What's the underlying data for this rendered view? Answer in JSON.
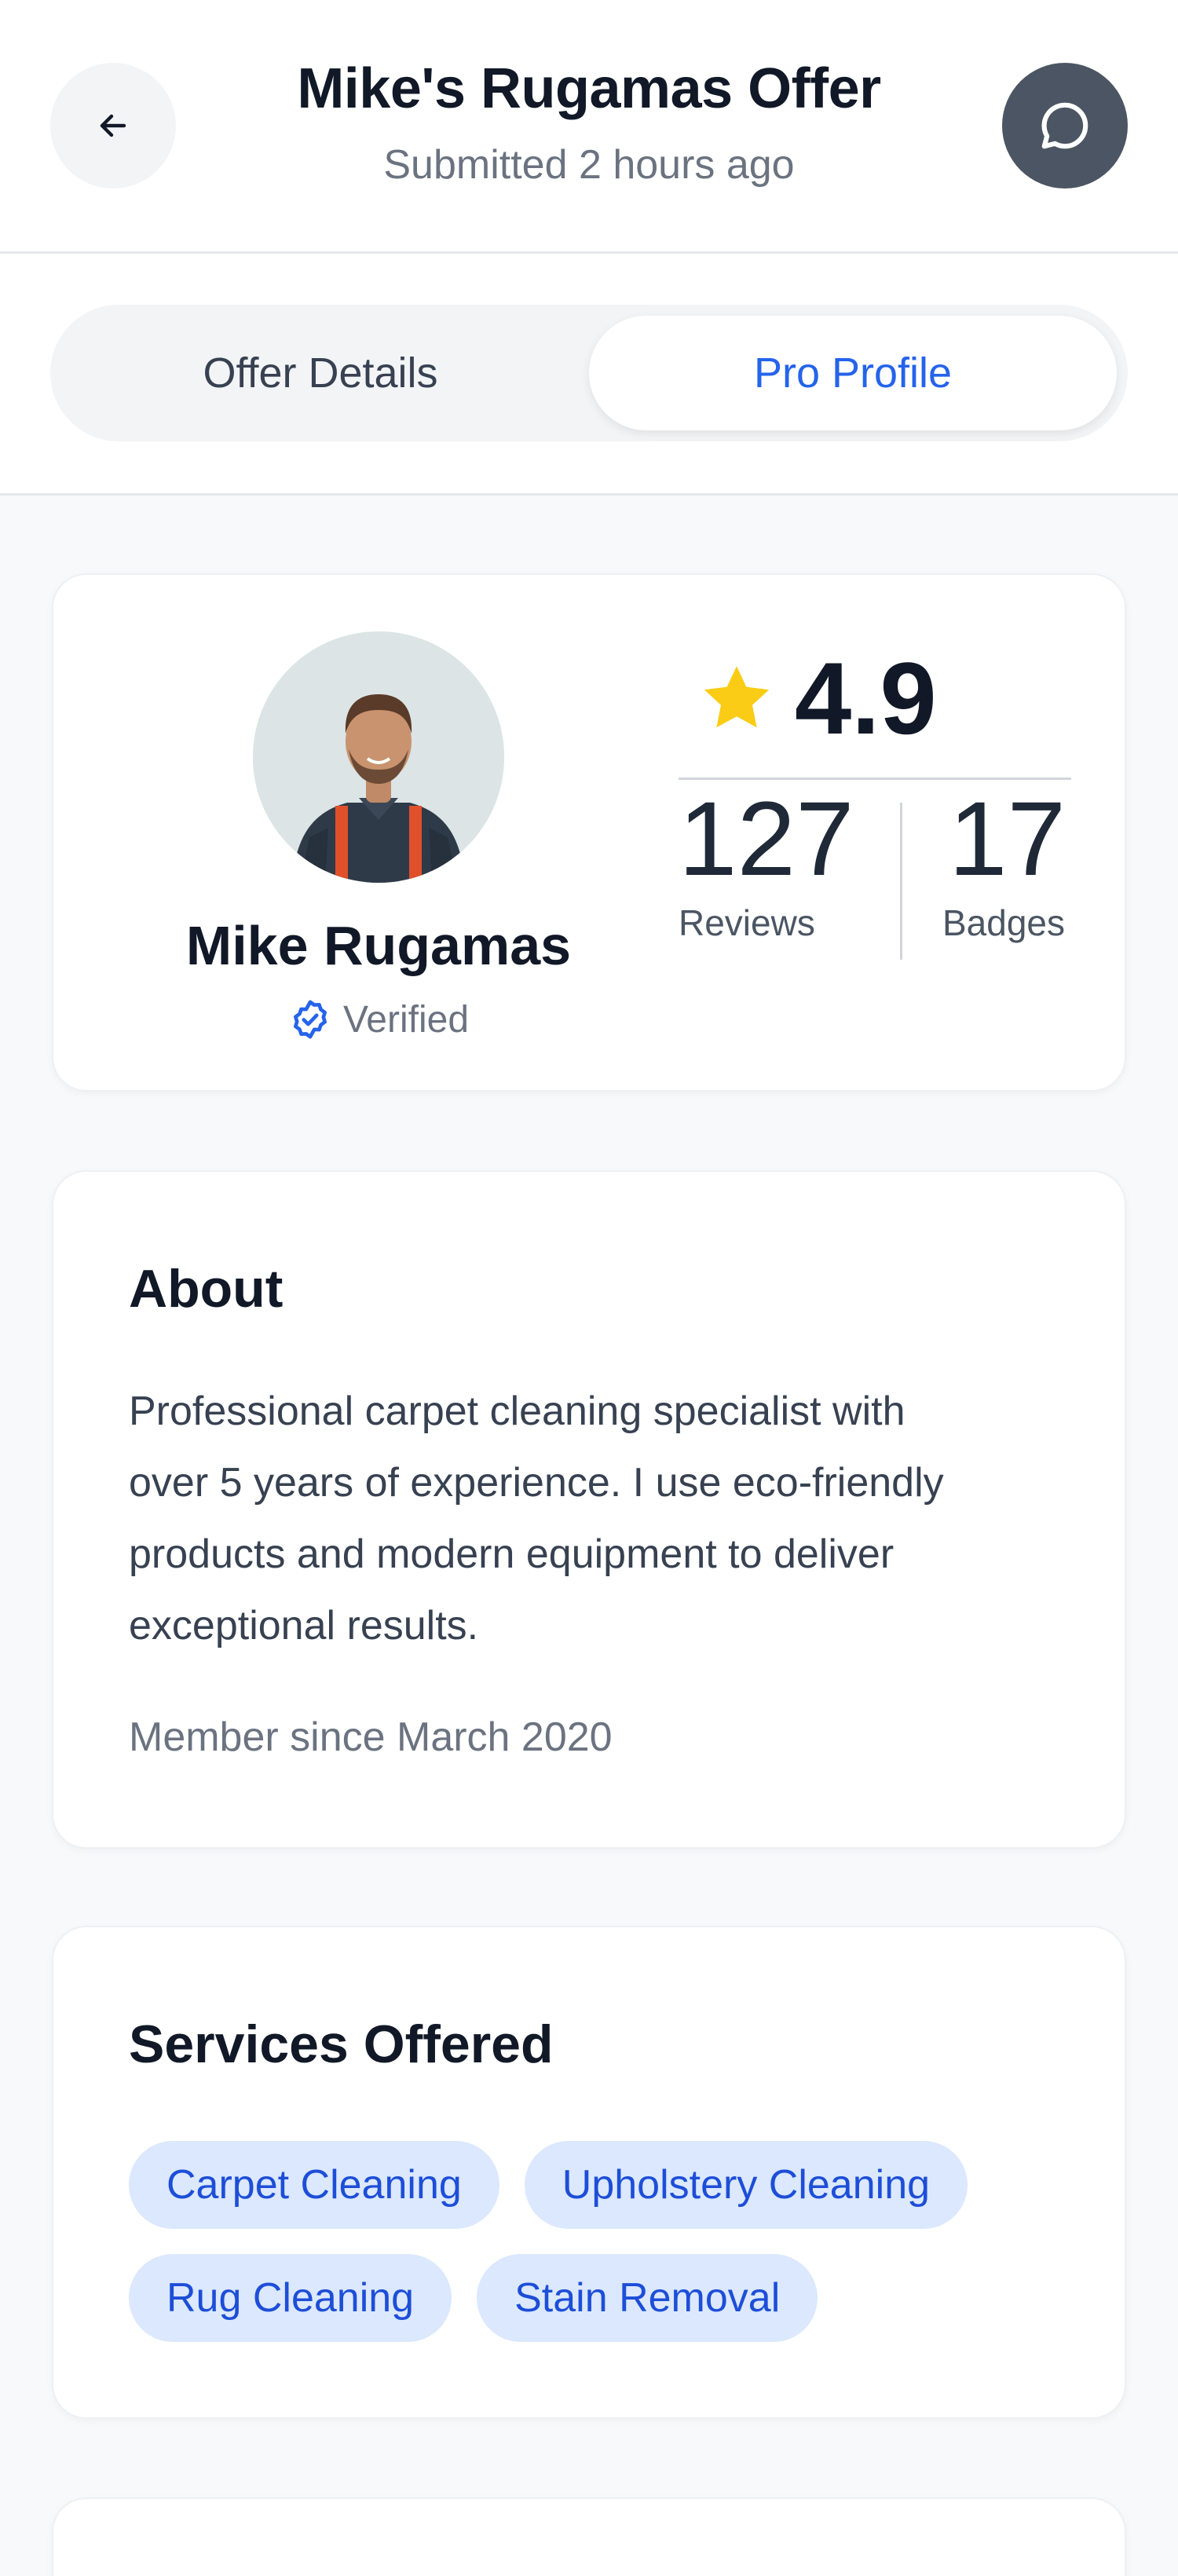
{
  "header": {
    "title": "Mike's Rugamas Offer",
    "subtitle": "Submitted 2 hours ago",
    "back_icon": "arrow-left-icon",
    "chat_icon": "chat-bubble-icon"
  },
  "tabs": [
    {
      "label": "Offer Details",
      "active": false
    },
    {
      "label": "Pro Profile",
      "active": true
    }
  ],
  "profile": {
    "name": "Mike Rugamas",
    "verified_label": "Verified",
    "rating": "4.9",
    "reviews_count": "127",
    "reviews_label": "Reviews",
    "badges_count": "17",
    "badges_label": "Badges"
  },
  "about": {
    "heading": "About",
    "lines": [
      "Professional carpet cleaning specialist with",
      "over 5 years of experience. I use eco-friendly",
      "products and modern equipment to deliver",
      "exceptional results."
    ],
    "member_since": "Member since March 2020"
  },
  "services": {
    "heading": "Services Offered",
    "items": [
      "Carpet Cleaning",
      "Upholstery Cleaning",
      "Rug Cleaning",
      "Stain Removal"
    ]
  },
  "colors": {
    "accent": "#2563EB",
    "chip_bg": "#DBE8FE",
    "star": "#FACC15",
    "chat_button": "#4B5563"
  }
}
